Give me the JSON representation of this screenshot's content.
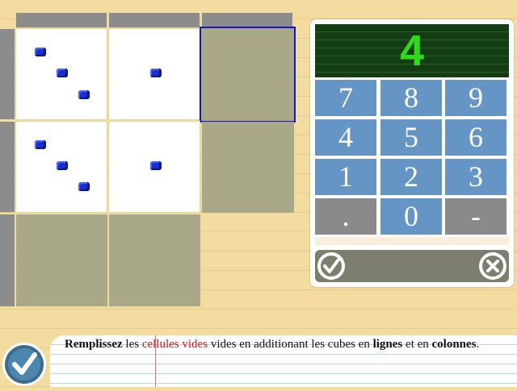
{
  "grid": {
    "rows": [
      [
        {
          "type": "white",
          "cubes": 3
        },
        {
          "type": "white",
          "cubes": 1
        },
        {
          "type": "empty",
          "selected": true
        }
      ],
      [
        {
          "type": "white",
          "cubes": 3
        },
        {
          "type": "white",
          "cubes": 1
        },
        {
          "type": "empty",
          "selected": false
        }
      ],
      [
        {
          "type": "empty",
          "selected": false
        },
        {
          "type": "empty",
          "selected": false
        }
      ]
    ],
    "colors": {
      "white_cell": "#ffffff",
      "empty_cell": "#a9a888",
      "header_bar": "#8c8c8c",
      "cube": "#1a2fcf",
      "selection": "#1515c8"
    }
  },
  "keypad": {
    "display": "4",
    "display_color": "#2bdc17",
    "keys": [
      [
        "7",
        "8",
        "9"
      ],
      [
        "4",
        "5",
        "6"
      ],
      [
        "1",
        "2",
        "3"
      ],
      [
        ".",
        "0",
        "-"
      ]
    ],
    "key_color": "#6495c4",
    "special_key_color": "#8a8a8a",
    "confirm_icon": "check-circle-icon",
    "clear_icon": "x-circle-icon"
  },
  "instruction": {
    "part1": "Remplissez",
    "part2": " les ",
    "part3": "cellules vides",
    "part4": " vides en additionant les cubes en ",
    "part5": "lignes",
    "part6": " et en ",
    "part7": "colonnes",
    "part8": "."
  },
  "validate_icon": "check-circle-icon"
}
